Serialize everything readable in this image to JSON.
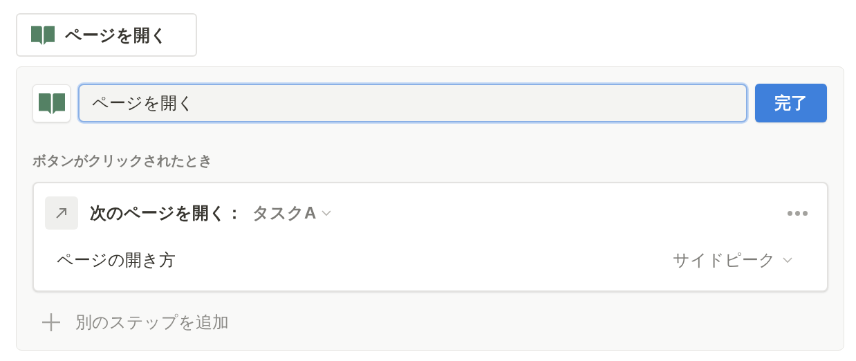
{
  "top_button": {
    "label": "ページを開く"
  },
  "editor": {
    "name_field": {
      "value": "ページを開く",
      "focused": true
    },
    "done_button": "完了",
    "trigger_label": "ボタンがクリックされたとき",
    "steps": [
      {
        "action": "次のページを開く：",
        "target": "タスクA",
        "options": [
          {
            "label": "ページの開き方",
            "value": "サイドピーク"
          }
        ]
      }
    ],
    "add_step": "別のステップを追加"
  }
}
